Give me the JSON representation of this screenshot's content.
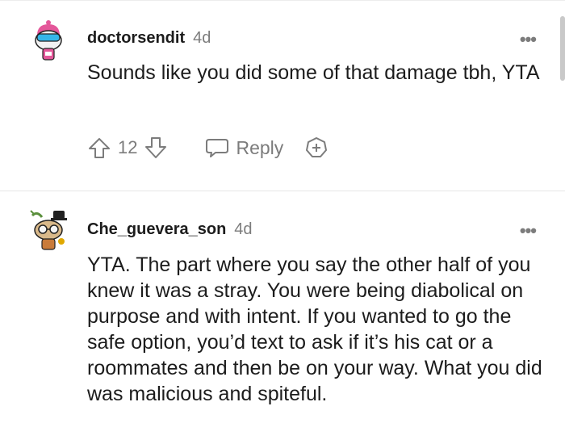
{
  "comments": [
    {
      "username": "doctorsendit",
      "time": "4d",
      "text": "Sounds like you did some of that damage tbh, YTA",
      "score": "12",
      "reply_label": "Reply",
      "avatar": "snoo-avatar-icon"
    },
    {
      "username": "Che_guevera_son",
      "time": "4d",
      "text": "YTA. The part where you say the other half of you knew it was a stray. You were being diabolical on purpose and with intent. If you wanted to go the safe option, you’d text to ask if it’s his cat or a roommates and then be on your way. What you did was malicious and spiteful.",
      "avatar": "snoo-avatar-icon"
    }
  ],
  "more_label": "•••",
  "colors": {
    "text": "#1c1c1c",
    "muted": "#7c7c7c",
    "divider": "#e6e6e6"
  }
}
